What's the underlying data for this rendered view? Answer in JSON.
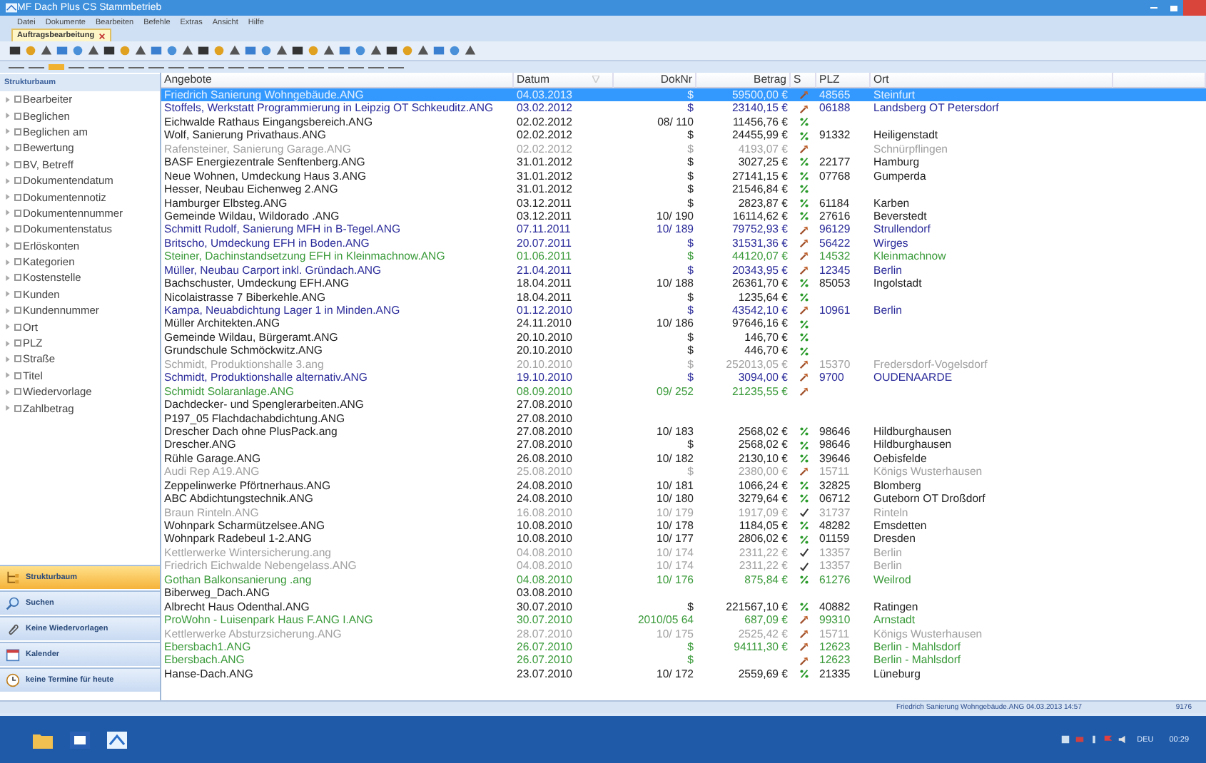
{
  "window": {
    "title": "MF Dach Plus CS  Stammbetrieb"
  },
  "menu": [
    "Datei",
    "Dokumente",
    "Bearbeiten",
    "Befehle",
    "Extras",
    "Ansicht",
    "Hilfe"
  ],
  "tabs": [
    {
      "label": "Auftragsbearbeitung",
      "selected": true
    }
  ],
  "sidebar": {
    "title": "Strukturbaum",
    "items": [
      {
        "label": "Bearbeiter",
        "checked": false
      },
      {
        "label": "Beglichen",
        "checked": false
      },
      {
        "label": "Beglichen am",
        "checked": false
      },
      {
        "label": "Bewertung",
        "checked": false
      },
      {
        "label": "BV, Betreff",
        "checked": false
      },
      {
        "label": "Dokumentendatum",
        "checked": false
      },
      {
        "label": "Dokumentennotiz",
        "checked": false
      },
      {
        "label": "Dokumentennummer",
        "checked": false
      },
      {
        "label": "Dokumentenstatus",
        "checked": false
      },
      {
        "label": "Erlöskonten",
        "checked": false
      },
      {
        "label": "Kategorien",
        "checked": false
      },
      {
        "label": "Kostenstelle",
        "checked": false
      },
      {
        "label": "Kunden",
        "checked": false
      },
      {
        "label": "Kundennummer",
        "checked": false
      },
      {
        "label": "Ort",
        "checked": false
      },
      {
        "label": "PLZ",
        "checked": false
      },
      {
        "label": "Straße",
        "checked": false
      },
      {
        "label": "Titel",
        "checked": false
      },
      {
        "label": "Wiedervorlage",
        "checked": false
      },
      {
        "label": "Zahlbetrag",
        "checked": false
      }
    ],
    "nav": [
      {
        "label": "Strukturbaum",
        "kind": "tree",
        "selected": true
      },
      {
        "label": "Suchen",
        "kind": "search",
        "selected": false
      },
      {
        "label": "Keine Wiedervorlagen",
        "kind": "clip",
        "selected": false
      },
      {
        "label": "Kalender",
        "kind": "calendar",
        "selected": false
      },
      {
        "label": "keine Termine für heute",
        "kind": "clock",
        "selected": false
      }
    ]
  },
  "table": {
    "columns": [
      "Angebote",
      "Datum",
      "DokNr",
      "Betrag",
      "S",
      "PLZ",
      "Ort"
    ],
    "rows": [
      {
        "name": "Friedrich Sanierung Wohngebäude.ANG",
        "date": "04.03.2013",
        "doc": "$",
        "amount": "59500,00 €",
        "kind": "wrench",
        "plz": "48565",
        "ort": "Steinfurt",
        "selected": true
      },
      {
        "name": "Stoffels, Werkstatt Programmierung in Leipzig OT Schkeuditz.ANG",
        "date": "03.02.2012",
        "doc": "$",
        "amount": "23140,15 €",
        "kind": "wrench",
        "plz": "06188",
        "ort": "Landsberg OT Petersdorf",
        "color": "#2a2a9a",
        "selected": false
      },
      {
        "name": "Eichwalde Rathaus Eingangsbereich.ANG",
        "date": "02.02.2012",
        "doc": "08/ 110",
        "amount": "11456,76 €",
        "kind": "percent",
        "color": "#222222",
        "selected": false
      },
      {
        "name": "Wolf, Sanierung Privathaus.ANG",
        "date": "02.02.2012",
        "doc": "$",
        "amount": "24455,99 €",
        "kind": "percent",
        "plz": "91332",
        "ort": "Heiligenstadt",
        "color": "#222222",
        "selected": false
      },
      {
        "name": "Rafensteiner, Sanierung Garage.ANG",
        "date": "02.02.2012",
        "doc": "$",
        "amount": "4193,07 €",
        "kind": "wrench",
        "ort": "Schnürpflingen",
        "color": "#a0a0a0",
        "selected": false
      },
      {
        "name": "BASF Energiezentrale Senftenberg.ANG",
        "date": "31.01.2012",
        "doc": "$",
        "amount": "3027,25 €",
        "kind": "percent",
        "plz": "22177",
        "ort": "Hamburg",
        "color": "#222222",
        "selected": false
      },
      {
        "name": "Neue Wohnen, Umdeckung Haus 3.ANG",
        "date": "31.01.2012",
        "doc": "$",
        "amount": "27141,15 €",
        "kind": "percent",
        "plz": "07768",
        "ort": "Gumperda",
        "color": "#222222",
        "selected": false
      },
      {
        "name": "Hesser, Neubau Eichenweg 2.ANG",
        "date": "31.01.2012",
        "doc": "$",
        "amount": "21546,84 €",
        "kind": "percent",
        "color": "#222222",
        "selected": false
      },
      {
        "name": "Hamburger Elbsteg.ANG",
        "date": "03.12.2011",
        "doc": "$",
        "amount": "2823,87 €",
        "kind": "percent",
        "plz": "61184",
        "ort": "Karben",
        "color": "#222222",
        "selected": false
      },
      {
        "name": "Gemeinde Wildau, Wildorado .ANG",
        "date": "03.12.2011",
        "doc": "10/ 190",
        "amount": "16114,62 €",
        "kind": "percent",
        "plz": "27616",
        "ort": "Beverstedt",
        "color": "#222222",
        "selected": false
      },
      {
        "name": "Schmitt Rudolf, Sanierung MFH in B-Tegel.ANG",
        "date": "07.11.2011",
        "doc": "10/ 189",
        "amount": "79752,93 €",
        "kind": "wrench",
        "plz": "96129",
        "ort": "Strullendorf",
        "color": "#2a2a9a",
        "selected": false
      },
      {
        "name": "Britscho, Umdeckung EFH in Boden.ANG",
        "date": "20.07.2011",
        "doc": "$",
        "amount": "31531,36 €",
        "kind": "wrench",
        "plz": "56422",
        "ort": "Wirges",
        "color": "#2a2a9a",
        "selected": false
      },
      {
        "name": "Steiner, Dachinstandsetzung EFH in Kleinmachnow.ANG",
        "date": "01.06.2011",
        "doc": "$",
        "amount": "44120,07 €",
        "kind": "wrench",
        "plz": "14532",
        "ort": "Kleinmachnow",
        "color": "#3a9a3a",
        "selected": false
      },
      {
        "name": "Müller, Neubau Carport inkl. Gründach.ANG",
        "date": "21.04.2011",
        "doc": "$",
        "amount": "20343,95 €",
        "kind": "wrench",
        "plz": "12345",
        "ort": "Berlin",
        "color": "#2a2a9a",
        "selected": false
      },
      {
        "name": "Bachschuster, Umdeckung EFH.ANG",
        "date": "18.04.2011",
        "doc": "10/ 188",
        "amount": "26361,70 €",
        "kind": "percent",
        "plz": "85053",
        "ort": "Ingolstadt",
        "color": "#222222",
        "selected": false
      },
      {
        "name": "Nicolaistrasse 7 Biberkehle.ANG",
        "date": "18.04.2011",
        "doc": "$",
        "amount": "1235,64 €",
        "kind": "percent",
        "color": "#222222",
        "selected": false
      },
      {
        "name": "Kampa, Neuabdichtung Lager 1 in Minden.ANG",
        "date": "01.12.2010",
        "doc": "$",
        "amount": "43542,10 €",
        "kind": "wrench",
        "plz": "10961",
        "ort": "Berlin",
        "color": "#2a2a9a",
        "selected": false
      },
      {
        "name": "Müller Architekten.ANG",
        "date": "24.11.2010",
        "doc": "10/ 186",
        "amount": "97646,16 €",
        "kind": "percent",
        "color": "#222222",
        "selected": false
      },
      {
        "name": "Gemeinde Wildau, Bürgeramt.ANG",
        "date": "20.10.2010",
        "doc": "$",
        "amount": "146,70 €",
        "kind": "percent",
        "color": "#222222",
        "selected": false
      },
      {
        "name": "Grundschule Schmöckwitz.ANG",
        "date": "20.10.2010",
        "doc": "$",
        "amount": "446,70 €",
        "kind": "percent",
        "color": "#222222",
        "selected": false
      },
      {
        "name": "Schmidt, Produktionshalle 3.ang",
        "date": "20.10.2010",
        "doc": "$",
        "amount": "252013,05 €",
        "kind": "wrench",
        "plz": "15370",
        "ort": "Fredersdorf-Vogelsdorf",
        "color": "#a0a0a0",
        "selected": false
      },
      {
        "name": "Schmidt, Produktionshalle alternativ.ANG",
        "date": "19.10.2010",
        "doc": "$",
        "amount": "3094,00 €",
        "kind": "wrench",
        "plz": "9700",
        "ort": "OUDENAARDE",
        "color": "#2a2a9a",
        "selected": false
      },
      {
        "name": "Schmidt Solaranlage.ANG",
        "date": "08.09.2010",
        "doc": "09/ 252",
        "amount": "21235,55 €",
        "kind": "wrench",
        "color": "#3a9a3a",
        "selected": false
      },
      {
        "name": "Dachdecker- und Spenglerarbeiten.ANG",
        "date": "27.08.2010",
        "color": "#222222",
        "selected": false
      },
      {
        "name": "P197_05 Flachdachabdichtung.ANG",
        "date": "27.08.2010",
        "color": "#222222",
        "selected": false
      },
      {
        "name": "Drescher Dach ohne PlusPack.ang",
        "date": "27.08.2010",
        "doc": "10/ 183",
        "amount": "2568,02 €",
        "kind": "percent",
        "plz": "98646",
        "ort": "Hildburghausen",
        "color": "#222222",
        "selected": false
      },
      {
        "name": "Drescher.ANG",
        "date": "27.08.2010",
        "doc": "$",
        "amount": "2568,02 €",
        "kind": "percent",
        "plz": "98646",
        "ort": "Hildburghausen",
        "color": "#222222",
        "selected": false
      },
      {
        "name": "Rühle Garage.ANG",
        "date": "26.08.2010",
        "doc": "10/ 182",
        "amount": "2130,10 €",
        "kind": "percent",
        "plz": "39646",
        "ort": "Oebisfelde",
        "color": "#222222",
        "selected": false
      },
      {
        "name": "Audi Rep A19.ANG",
        "date": "25.08.2010",
        "doc": "$",
        "amount": "2380,00 €",
        "kind": "wrench",
        "plz": "15711",
        "ort": "Königs Wusterhausen",
        "color": "#a0a0a0",
        "selected": false
      },
      {
        "name": "Zeppelinwerke Pförtnerhaus.ANG",
        "date": "24.08.2010",
        "doc": "10/ 181",
        "amount": "1066,24 €",
        "kind": "percent",
        "plz": "32825",
        "ort": "Blomberg",
        "color": "#222222",
        "selected": false
      },
      {
        "name": "ABC Abdichtungstechnik.ANG",
        "date": "24.08.2010",
        "doc": "10/ 180",
        "amount": "3279,64 €",
        "kind": "percent",
        "plz": "06712",
        "ort": "Guteborn OT Droßdorf",
        "color": "#222222",
        "selected": false
      },
      {
        "name": "Braun Rinteln.ANG",
        "date": "16.08.2010",
        "doc": "10/ 179",
        "amount": "1917,09 €",
        "kind": "check",
        "plz": "31737",
        "ort": "Rinteln",
        "color": "#a0a0a0",
        "selected": false
      },
      {
        "name": "Wohnpark Scharmützelsee.ANG",
        "date": "10.08.2010",
        "doc": "10/ 178",
        "amount": "1184,05 €",
        "kind": "percent",
        "plz": "48282",
        "ort": "Emsdetten",
        "color": "#222222",
        "selected": false
      },
      {
        "name": "Wohnpark Radebeul 1-2.ANG",
        "date": "10.08.2010",
        "doc": "10/ 177",
        "amount": "2806,02 €",
        "kind": "percent",
        "plz": "01159",
        "ort": "Dresden",
        "color": "#222222",
        "selected": false
      },
      {
        "name": "Kettlerwerke Wintersicherung.ang",
        "date": "04.08.2010",
        "doc": "10/ 174",
        "amount": "2311,22 €",
        "kind": "check",
        "plz": "13357",
        "ort": "Berlin",
        "color": "#a0a0a0",
        "selected": false
      },
      {
        "name": "Friedrich Eichwalde Nebengelass.ANG",
        "date": "04.08.2010",
        "doc": "10/ 174",
        "amount": "2311,22 €",
        "kind": "check",
        "plz": "13357",
        "ort": "Berlin",
        "color": "#a0a0a0",
        "selected": false
      },
      {
        "name": "Gothan Balkonsanierung .ang",
        "date": "04.08.2010",
        "doc": "10/ 176",
        "amount": "875,84 €",
        "kind": "percent",
        "plz": "61276",
        "ort": "Weilrod",
        "color": "#3a9a3a",
        "selected": false
      },
      {
        "name": "Biberweg_Dach.ANG",
        "date": "03.08.2010",
        "color": "#222222",
        "selected": false
      },
      {
        "name": "Albrecht Haus Odenthal.ANG",
        "date": "30.07.2010",
        "doc": "$",
        "amount": "221567,10 €",
        "kind": "percent",
        "plz": "40882",
        "ort": "Ratingen",
        "color": "#222222",
        "selected": false
      },
      {
        "name": "ProWohn - Luisenpark Haus F.ANG I.ANG",
        "date": "30.07.2010",
        "doc": "2010/05 64",
        "amount": "687,09 €",
        "kind": "wrench",
        "plz": "99310",
        "ort": "Arnstadt",
        "color": "#3a9a3a",
        "selected": false
      },
      {
        "name": "Kettlerwerke Absturzsicherung.ANG",
        "date": "28.07.2010",
        "doc": "10/ 175",
        "amount": "2525,42 €",
        "kind": "wrench",
        "plz": "15711",
        "ort": "Königs Wusterhausen",
        "color": "#a0a0a0",
        "selected": false
      },
      {
        "name": "Ebersbach1.ANG",
        "date": "26.07.2010",
        "doc": "$",
        "amount": "94111,30 €",
        "kind": "wrench",
        "plz": "12623",
        "ort": "Berlin - Mahlsdorf",
        "color": "#3a9a3a",
        "selected": false
      },
      {
        "name": "Ebersbach.ANG",
        "date": "26.07.2010",
        "doc": "$",
        "kind": "wrench",
        "plz": "12623",
        "ort": "Berlin - Mahlsdorf",
        "color": "#3a9a3a",
        "selected": false
      },
      {
        "name": "Hanse-Dach.ANG",
        "date": "23.07.2010",
        "doc": "10/ 172",
        "amount": "2559,69 €",
        "kind": "percent",
        "plz": "21335",
        "ort": "Lüneburg",
        "color": "#222222",
        "selected": false
      }
    ]
  },
  "status_bar": {
    "message": "Friedrich Sanierung Wohngebäude.ANG 04.03.2013 14:57",
    "count": "9176"
  },
  "taskbar": {
    "language": "DEU",
    "time": "00:29"
  }
}
